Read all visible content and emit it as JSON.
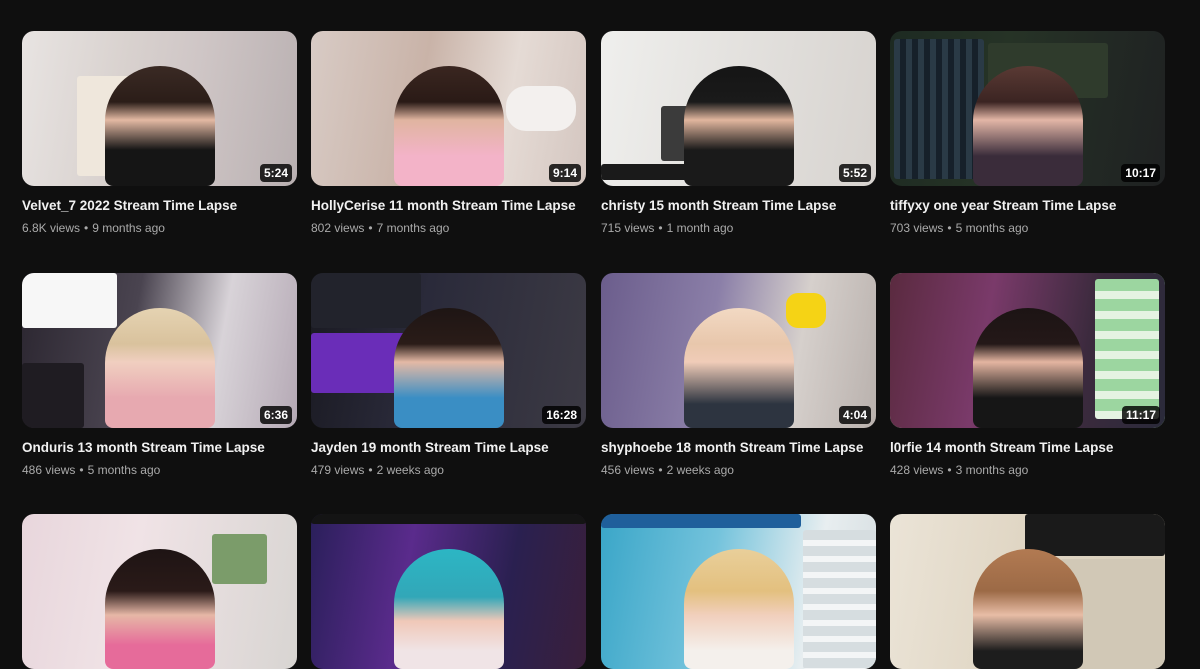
{
  "videos": [
    {
      "title": "Velvet_7 2022 Stream Time Lapse",
      "views": "6.8K views",
      "age": "9 months ago",
      "duration": "5:24"
    },
    {
      "title": "HollyCerise 11 month Stream Time Lapse",
      "views": "802 views",
      "age": "7 months ago",
      "duration": "9:14"
    },
    {
      "title": "christy 15 month Stream Time Lapse",
      "views": "715 views",
      "age": "1 month ago",
      "duration": "5:52"
    },
    {
      "title": "tiffyxy one year Stream Time Lapse",
      "views": "703 views",
      "age": "5 months ago",
      "duration": "10:17"
    },
    {
      "title": "Onduris 13 month Stream Time Lapse",
      "views": "486 views",
      "age": "5 months ago",
      "duration": "6:36"
    },
    {
      "title": "Jayden 19 month Stream Time Lapse",
      "views": "479 views",
      "age": "2 weeks ago",
      "duration": "16:28"
    },
    {
      "title": "shyphoebe 18 month Stream Time Lapse",
      "views": "456 views",
      "age": "2 weeks ago",
      "duration": "4:04"
    },
    {
      "title": "l0rfie 14 month Stream Time Lapse",
      "views": "428 views",
      "age": "3 months ago",
      "duration": "11:17"
    },
    {
      "title": "",
      "views": "",
      "age": "",
      "duration": ""
    },
    {
      "title": "",
      "views": "",
      "age": "",
      "duration": ""
    },
    {
      "title": "",
      "views": "",
      "age": "",
      "duration": ""
    },
    {
      "title": "",
      "views": "",
      "age": "",
      "duration": ""
    }
  ],
  "separator": "•"
}
